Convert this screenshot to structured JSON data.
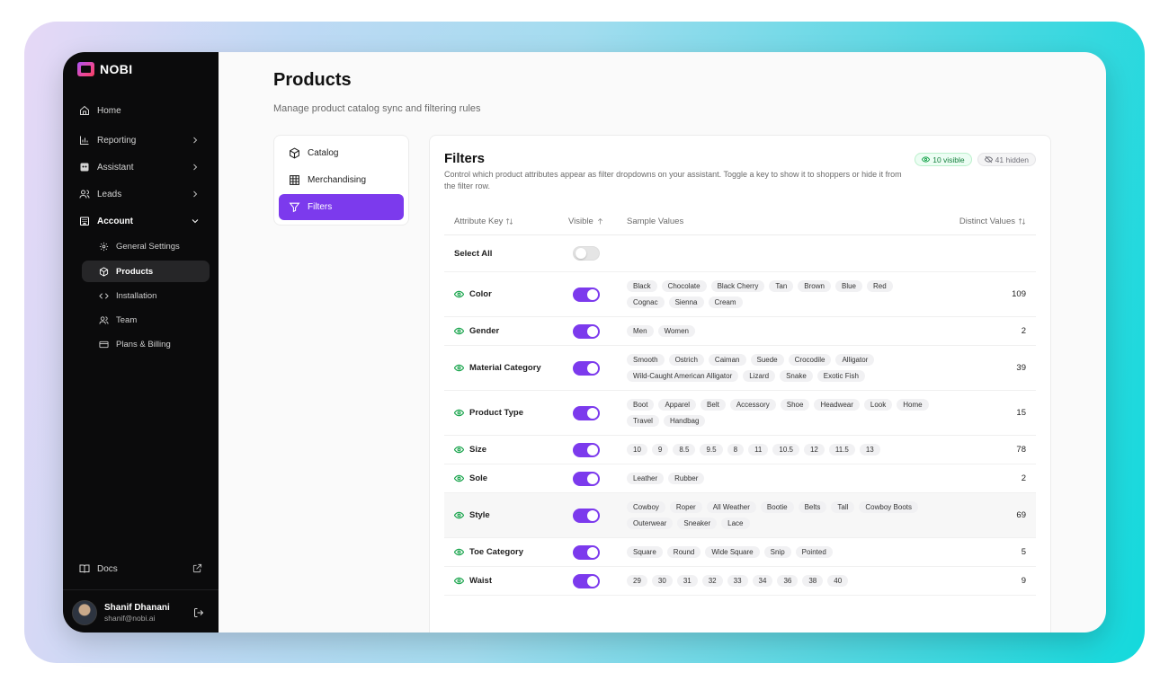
{
  "app": {
    "logo_text": "NOBI"
  },
  "sidebar": {
    "items": [
      {
        "label": "Home",
        "icon": "home-icon",
        "chevron": false
      },
      {
        "label": "Reporting",
        "icon": "chart-icon",
        "chevron": true
      },
      {
        "label": "Assistant",
        "icon": "bot-icon",
        "chevron": true
      },
      {
        "label": "Leads",
        "icon": "users-icon",
        "chevron": true
      },
      {
        "label": "Account",
        "icon": "building-icon",
        "chevron": true,
        "expanded": true
      }
    ],
    "account_sub": [
      {
        "label": "General Settings",
        "icon": "gear-icon"
      },
      {
        "label": "Products",
        "icon": "box-icon",
        "active": true
      },
      {
        "label": "Installation",
        "icon": "code-icon"
      },
      {
        "label": "Team",
        "icon": "team-icon"
      },
      {
        "label": "Plans & Billing",
        "icon": "card-icon"
      }
    ],
    "docs_label": "Docs",
    "user": {
      "name": "Shanif Dhanani",
      "email": "shanif@nobi.ai"
    }
  },
  "page": {
    "title": "Products",
    "subtitle": "Manage product catalog sync and filtering rules"
  },
  "tabs": [
    {
      "label": "Catalog",
      "icon": "cube-icon"
    },
    {
      "label": "Merchandising",
      "icon": "grid-icon"
    },
    {
      "label": "Filters",
      "icon": "filter-icon",
      "active": true
    }
  ],
  "filters": {
    "title": "Filters",
    "description": "Control which product attributes appear as filter dropdowns on your assistant. Toggle a key to show it to shoppers or hide it from the filter row.",
    "visible_badge": "10 visible",
    "hidden_badge": "41 hidden",
    "columns": {
      "key": "Attribute Key",
      "visible": "Visible",
      "samples": "Sample Values",
      "distinct": "Distinct Values"
    },
    "select_all_label": "Select All",
    "rows": [
      {
        "key": "Color",
        "samples": [
          "Black",
          "Chocolate",
          "Black Cherry",
          "Tan",
          "Brown",
          "Blue",
          "Red",
          "Cognac",
          "Sienna",
          "Cream"
        ],
        "distinct": "109"
      },
      {
        "key": "Gender",
        "samples": [
          "Men",
          "Women"
        ],
        "distinct": "2"
      },
      {
        "key": "Material Category",
        "samples": [
          "Smooth",
          "Ostrich",
          "Caiman",
          "Suede",
          "Crocodile",
          "Alligator",
          "Wild-Caught American Alligator",
          "Lizard",
          "Snake",
          "Exotic Fish"
        ],
        "distinct": "39"
      },
      {
        "key": "Product Type",
        "samples": [
          "Boot",
          "Apparel",
          "Belt",
          "Accessory",
          "Shoe",
          "Headwear",
          "Look",
          "Home",
          "Travel",
          "Handbag"
        ],
        "distinct": "15"
      },
      {
        "key": "Size",
        "samples": [
          "10",
          "9",
          "8.5",
          "9.5",
          "8",
          "11",
          "10.5",
          "12",
          "11.5",
          "13"
        ],
        "distinct": "78"
      },
      {
        "key": "Sole",
        "samples": [
          "Leather",
          "Rubber"
        ],
        "distinct": "2"
      },
      {
        "key": "Style",
        "samples": [
          "Cowboy",
          "Roper",
          "All Weather",
          "Bootie",
          "Belts",
          "Tall",
          "Cowboy Boots",
          "Outerwear",
          "Sneaker",
          "Lace"
        ],
        "distinct": "69",
        "highlight": true
      },
      {
        "key": "Toe Category",
        "samples": [
          "Square",
          "Round",
          "Wide Square",
          "Snip",
          "Pointed"
        ],
        "distinct": "5"
      },
      {
        "key": "Waist",
        "samples": [
          "29",
          "30",
          "31",
          "32",
          "33",
          "34",
          "36",
          "38",
          "40"
        ],
        "distinct": "9"
      }
    ]
  },
  "colors": {
    "accent": "#7c3aed",
    "sidebar_bg": "#0b0b0c",
    "visible_green": "#16a34a"
  }
}
